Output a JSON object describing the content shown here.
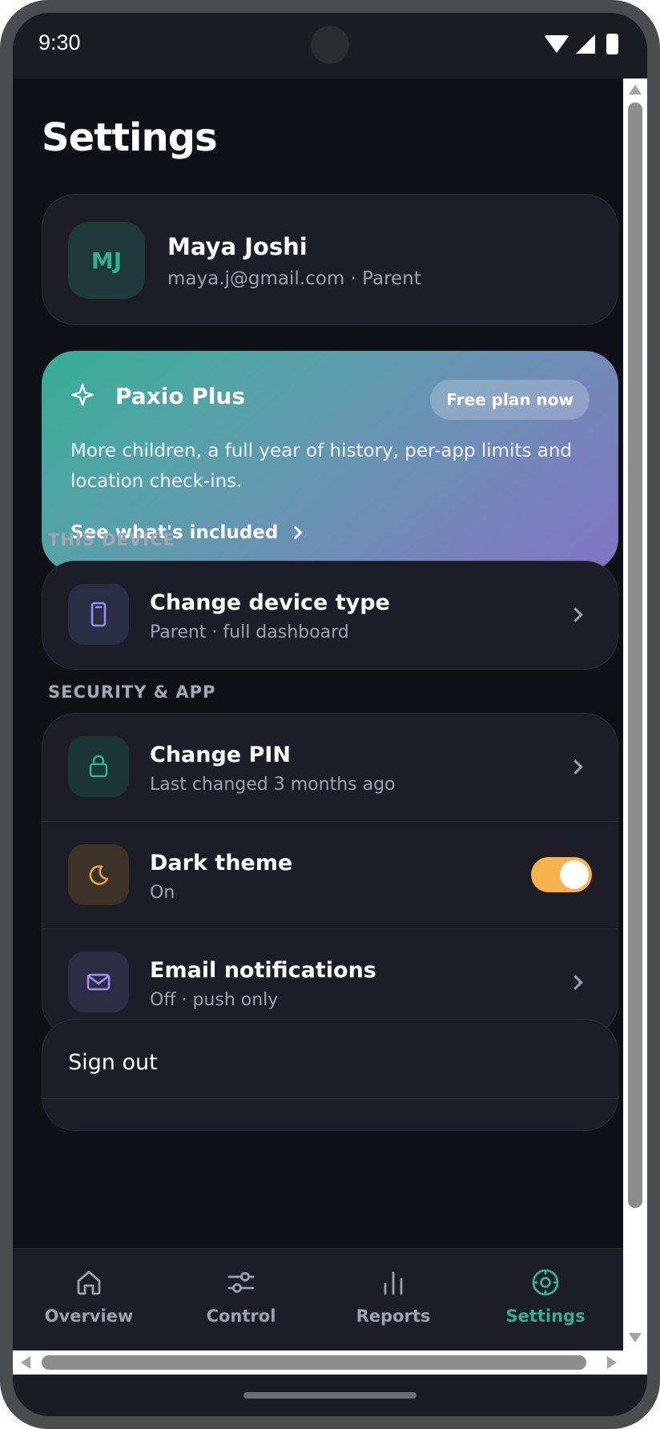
{
  "status_bar": {
    "time": "9:30"
  },
  "header": {
    "title": "Settings"
  },
  "profile": {
    "initials": "MJ",
    "name": "Maya Joshi",
    "subtitle": "maya.j@gmail.com · Parent"
  },
  "plus": {
    "title": "Paxio Plus",
    "badge": "Free plan now",
    "description": "More children, a full year of history, per-app limits and location check-ins.",
    "link": "See what's included",
    "icon": "sparkle-icon"
  },
  "sections": {
    "device": {
      "label": "THIS DEVICE",
      "items": [
        {
          "title": "Change device type",
          "subtitle": "Parent · full dashboard",
          "icon": "phone-icon"
        }
      ]
    },
    "security": {
      "label": "SECURITY & APP",
      "items": [
        {
          "title": "Change PIN",
          "subtitle": "Last changed 3 months ago",
          "icon": "lock-icon"
        },
        {
          "title": "Dark theme",
          "subtitle": "On",
          "icon": "moon-icon",
          "toggle_on": true
        },
        {
          "title": "Email notifications",
          "subtitle": "Off · push only",
          "icon": "mail-icon"
        }
      ]
    }
  },
  "signout": {
    "label": "Sign out"
  },
  "tabs": [
    {
      "label": "Overview",
      "icon": "home-icon"
    },
    {
      "label": "Control",
      "icon": "sliders-icon"
    },
    {
      "label": "Reports",
      "icon": "bar-chart-icon"
    },
    {
      "label": "Settings",
      "icon": "settings-icon",
      "active": true
    }
  ],
  "colors": {
    "accent": "#33b08d",
    "toggle": "#f8b24c",
    "background": "#101117",
    "card": "#1c1d26"
  }
}
